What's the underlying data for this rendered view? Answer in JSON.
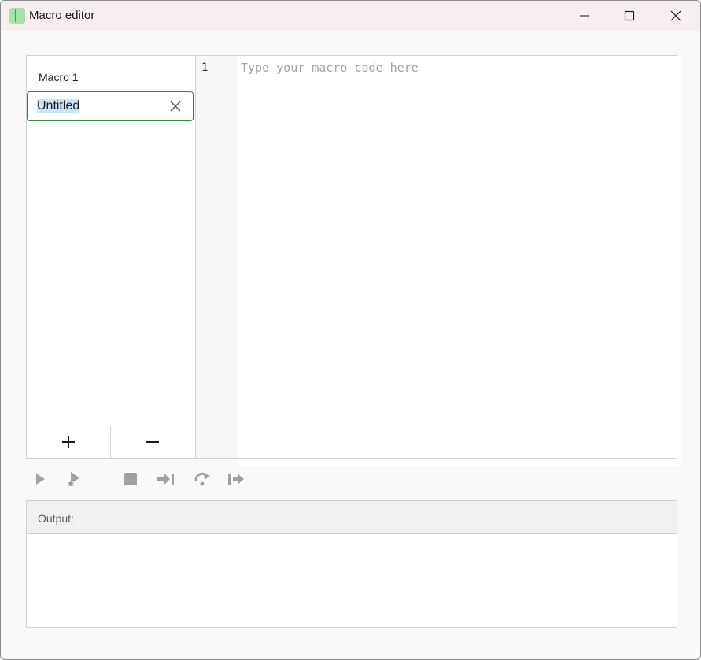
{
  "window": {
    "title": "Macro editor",
    "accent_color": "#2e8b3a",
    "icon_color": "#a9e2a9",
    "controls": [
      "minimize-icon",
      "maximize-icon",
      "close-icon"
    ]
  },
  "macro_list": {
    "items": [
      {
        "label": "Macro 1"
      }
    ],
    "rename_field": {
      "value": "Untitled",
      "selected": true,
      "clear_icon": "clear-icon"
    },
    "buttons": {
      "add": "plus-icon",
      "remove": "minus-icon"
    }
  },
  "editor": {
    "line_numbers": [
      "1"
    ],
    "placeholder": "Type your macro code here",
    "value": ""
  },
  "toolbar": {
    "buttons": [
      {
        "name": "run",
        "icon": "play-icon",
        "enabled": false
      },
      {
        "name": "debug",
        "icon": "debug-icon",
        "enabled": false
      },
      {
        "name": "stop",
        "icon": "stop-icon",
        "enabled": false
      },
      {
        "name": "step-into",
        "icon": "step-into-icon",
        "enabled": false
      },
      {
        "name": "step-over",
        "icon": "step-over-icon",
        "enabled": false
      },
      {
        "name": "step-out",
        "icon": "step-out-icon",
        "enabled": false
      }
    ]
  },
  "output": {
    "label": "Output:",
    "content": ""
  }
}
